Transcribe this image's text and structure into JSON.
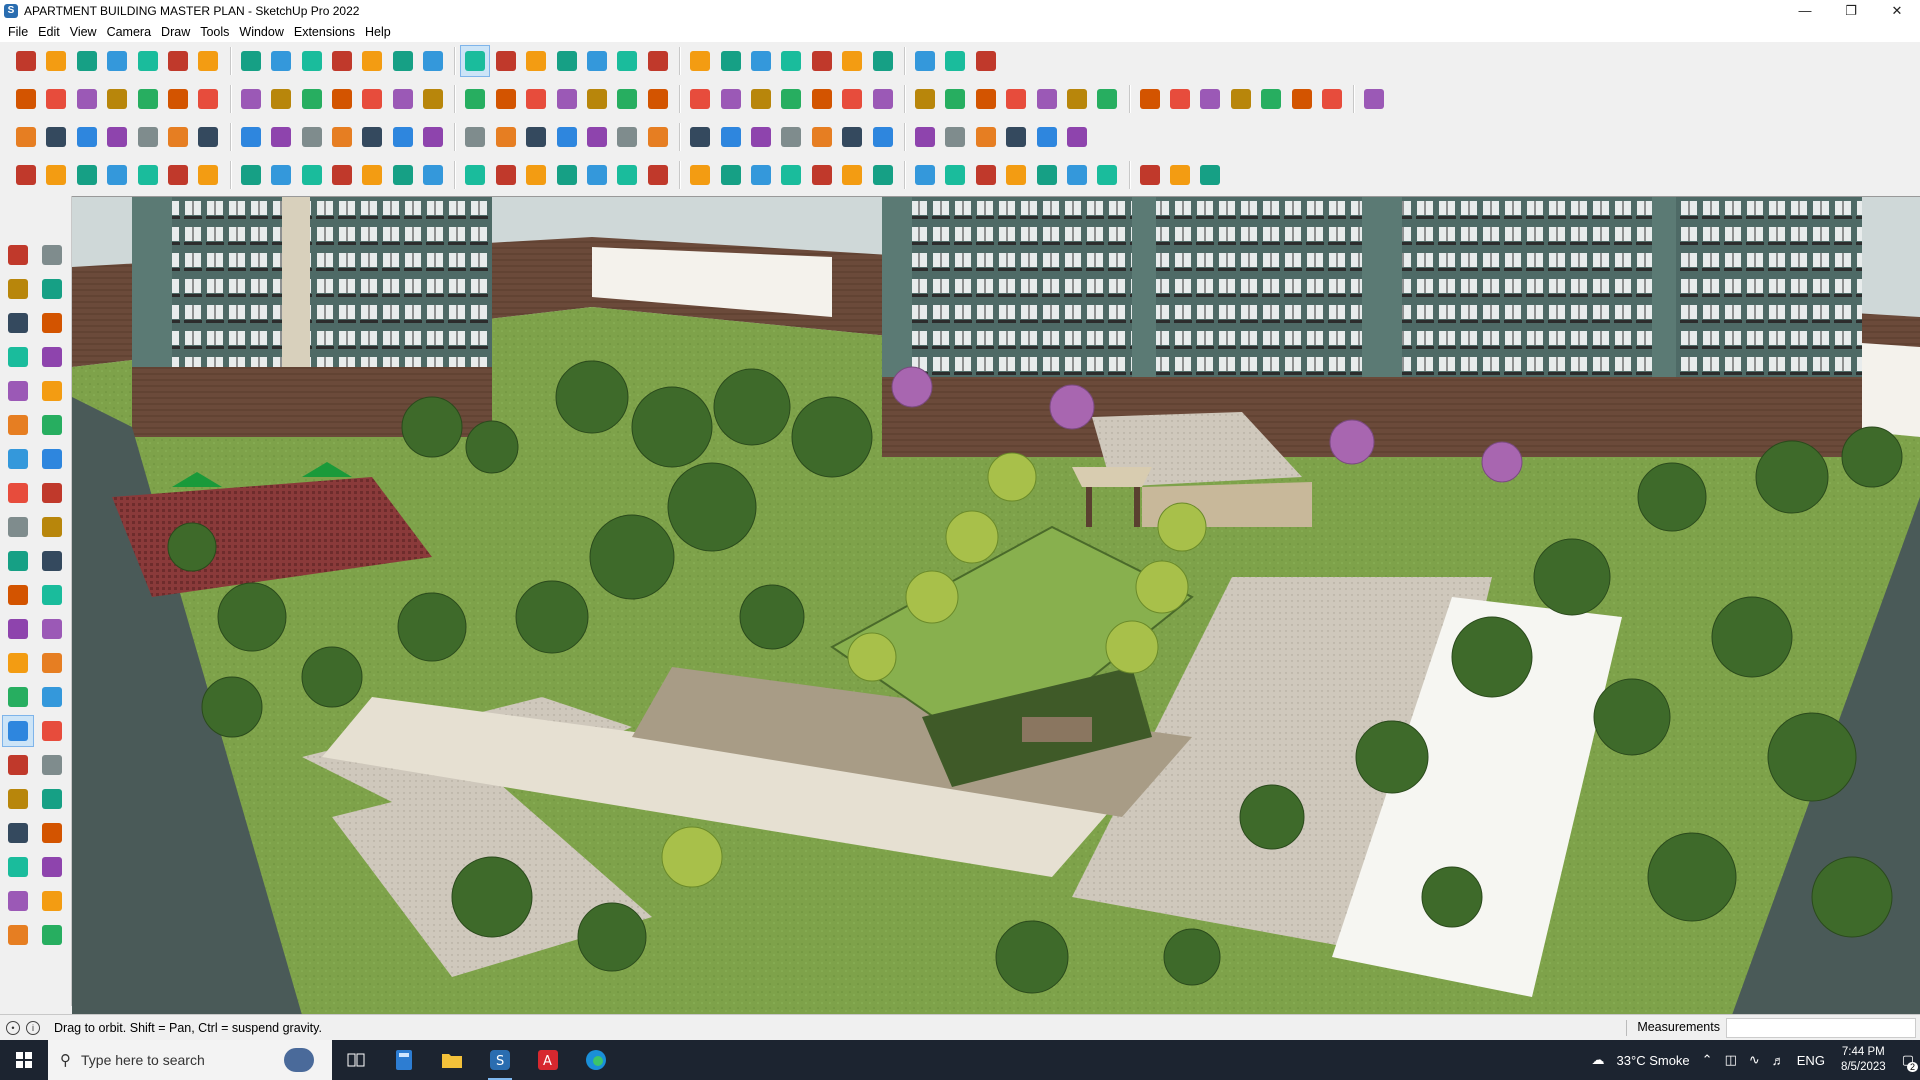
{
  "window": {
    "title": "APARTMENT BUILDING MASTER PLAN - SketchUp Pro 2022",
    "app_icon": "sketchup-icon",
    "controls": [
      "minimize",
      "restore",
      "close"
    ]
  },
  "menu": [
    "File",
    "Edit",
    "View",
    "Camera",
    "Draw",
    "Tools",
    "Window",
    "Extensions",
    "Help"
  ],
  "toolbar_rows": [
    {
      "icons": [
        "zoom-icon",
        "select-icon",
        "eraser-icon",
        "line-icon",
        "arc-icon",
        "rectangle-icon",
        "push-pull-icon",
        "follow-me-icon",
        "move-icon",
        "rotate-icon",
        "scale-icon",
        "tape-measure-icon",
        "text-icon",
        "paint-bucket-icon",
        "orbit-icon",
        "pan-icon",
        "zoom-window-icon",
        "zoom-extents-icon",
        "section-plane-icon",
        "layers-icon",
        "outliner-icon",
        "styles-icon",
        "warehouse-icon",
        "extension-warehouse-icon",
        "sandbox-icon",
        "flip-icon",
        "solid-tools-icon",
        "intersect-icon",
        "undo-icon",
        "redo-icon",
        "model-info-icon"
      ]
    },
    {
      "icons": [
        "component-icon",
        "group-icon",
        "material-icon",
        "iso-view-icon",
        "top-view-icon",
        "front-view-icon",
        "right-view-icon",
        "back-view-icon",
        "left-view-icon",
        "bottom-view-icon",
        "xray-icon",
        "wireframe-icon",
        "hidden-line-icon",
        "shaded-icon",
        "textured-icon",
        "monochrome-icon",
        "house-icon",
        "roof-icon",
        "wall-icon",
        "window-icon",
        "door-icon",
        "stairs-icon",
        "fence-icon",
        "tree-icon",
        "shadow-icon",
        "fog-icon",
        "match-photo-icon",
        "photo-texture-icon",
        "layer-on-icon",
        "geo-location-icon",
        "pencil-icon",
        "circle-icon",
        "polygon-icon",
        "freehand-icon",
        "ellipse-icon",
        "parallelogram-icon",
        "curve-icon",
        "spiral-icon",
        "bezier-icon",
        "weld-icon",
        "explode-icon",
        "move-red-icon",
        "soften-icon"
      ]
    },
    {
      "icons": [
        "box-icon",
        "plane-icon",
        "slab-icon",
        "terrain-icon",
        "flat-icon",
        "offset-icon",
        "frame-icon",
        "grid-icon",
        "path-icon",
        "spline-icon",
        "joint-icon",
        "cross-icon",
        "multi-icon",
        "snap-icon",
        "cone-icon",
        "pyramid-icon",
        "warning-icon",
        "loop-icon",
        "ring-icon",
        "chain-icon",
        "star-icon",
        "cut-icon",
        "hook-icon",
        "stack-icon",
        "tile-icon",
        "brick-icon",
        "tag-icon",
        "pattern-icon",
        "panel-icon",
        "mesh-icon",
        "matrix-icon",
        "plus-icon",
        "points-icon",
        "hatch-icon"
      ]
    },
    {
      "icons": [
        "line-tool-icon",
        "curve-tool-icon",
        "drill-icon",
        "scissors-icon",
        "cog-icon",
        "cloud-icon",
        "hose-icon",
        "dome-icon",
        "globe-icon",
        "bend-icon",
        "angle-icon",
        "corner-icon",
        "knife-icon",
        "spring-icon",
        "cage-icon",
        "lamp-icon",
        "bars-icon",
        "gear-bar-icon",
        "hand-icon",
        "leaf-icon",
        "plane-arrow-icon",
        "shelf-icon",
        "stripe-icon",
        "fan-icon",
        "rail-icon",
        "barrel-icon",
        "slope-icon",
        "wave-icon",
        "step-icon",
        "column-icon",
        "lattice-icon",
        "stairs-rail-icon",
        "comb-icon",
        "fan-blade-icon",
        "ramp-icon",
        "cushion-icon",
        "roof-frame-icon",
        "lotus-icon"
      ]
    }
  ],
  "left_tools": [
    "select-icon",
    "orbit-small-icon",
    "paint-bucket-icon",
    "eraser-icon",
    "component-icon",
    "pencil-icon",
    "line-icon",
    "freehand-icon",
    "rectangle-icon",
    "rotated-rect-icon",
    "circle-icon",
    "polygon-icon",
    "arc-icon",
    "pie-icon",
    "two-point-arc-icon",
    "three-point-arc-icon",
    "move-icon",
    "push-pull-icon",
    "rotate-icon",
    "follow-me-icon",
    "scale-icon",
    "offset-icon",
    "tape-measure-icon",
    "dimension-icon",
    "protractor-icon",
    "text-icon",
    "axes-icon",
    "3d-text-icon",
    "orbit-icon",
    "pan-icon",
    "zoom-icon",
    "zoom-window-icon",
    "zoom-extents-icon",
    "previous-view-icon",
    "position-camera-icon",
    "look-around-icon",
    "walk-icon",
    "section-plane-icon",
    "section-display-icon",
    "section-fill-icon",
    "layers-icon",
    "scenes-icon"
  ],
  "viewport": {
    "description_hint": "3D model viewport"
  },
  "status": {
    "hint": "Drag to orbit. Shift = Pan, Ctrl = suspend gravity.",
    "measurements_label": "Measurements",
    "measurements_value": ""
  },
  "taskbar": {
    "search_placeholder": "Type here to search",
    "weather": "33°C  Smoke",
    "language": "ENG",
    "time": "7:44 PM",
    "date": "8/5/2023",
    "notifications_count": "2"
  },
  "colors": {
    "sky": "#cfd8d8",
    "lawn": "#7ea24a",
    "brick": "#6b4a3a",
    "facade": "#5b7a74",
    "path": "#c9c2b6",
    "taskbar": "#1c2430"
  }
}
